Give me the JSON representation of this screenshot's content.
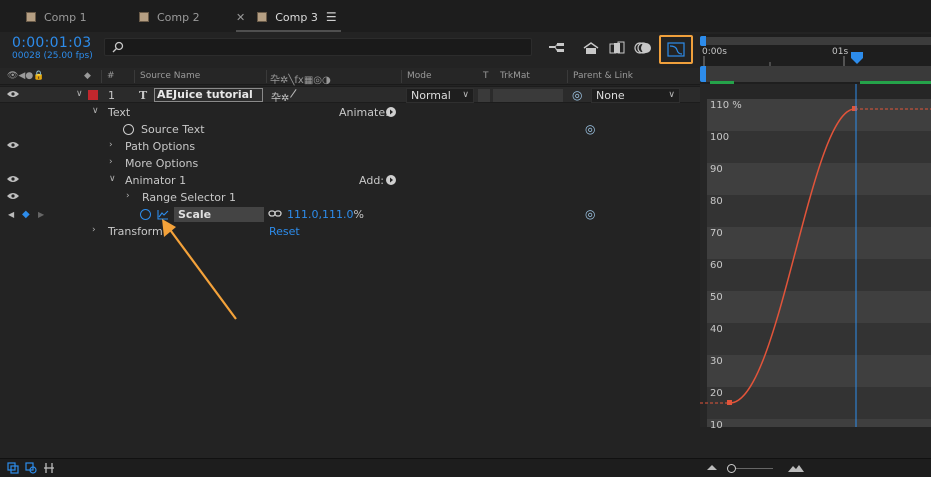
{
  "tabs": [
    {
      "label": "Comp 1",
      "active": false
    },
    {
      "label": "Comp 2",
      "active": false
    },
    {
      "label": "Comp 3",
      "active": true
    }
  ],
  "header": {
    "timecode": "0:00:01:03",
    "frames_fps": "00028 (25.00 fps)",
    "search_placeholder": ""
  },
  "columns": {
    "number": "#",
    "source_name": "Source Name",
    "mode": "Mode",
    "trackmatte_t": "T",
    "trkmat": "TrkMat",
    "parent_link": "Parent & Link"
  },
  "layer": {
    "index": "1",
    "type_glyph": "T",
    "name": "AEJuice tutorial",
    "mode": "Normal",
    "parent": "None",
    "label_color": "#c0272d"
  },
  "properties": {
    "text": "Text",
    "animate_label": "Animate:",
    "source_text": "Source Text",
    "path_options": "Path Options",
    "more_options": "More Options",
    "animator": "Animator 1",
    "add_label": "Add:",
    "range_selector": "Range Selector 1",
    "scale_label": "Scale",
    "scale_value": "111.0,111.0",
    "scale_unit": "%",
    "transform": "Transform",
    "reset": "Reset"
  },
  "timeline": {
    "ruler_start": "0:00s",
    "ruler_mark": "01s"
  },
  "graph": {
    "y_labels": [
      "110 %",
      "100",
      "90",
      "80",
      "70",
      "60",
      "50",
      "40",
      "30",
      "20",
      "10"
    ],
    "curve_color": "#e2543a",
    "playhead_color": "#2d8ceb"
  },
  "colors": {
    "accent": "#2d8ceb",
    "highlight_box": "#f0a03c",
    "annotation_arrow": "#f4a23a"
  }
}
